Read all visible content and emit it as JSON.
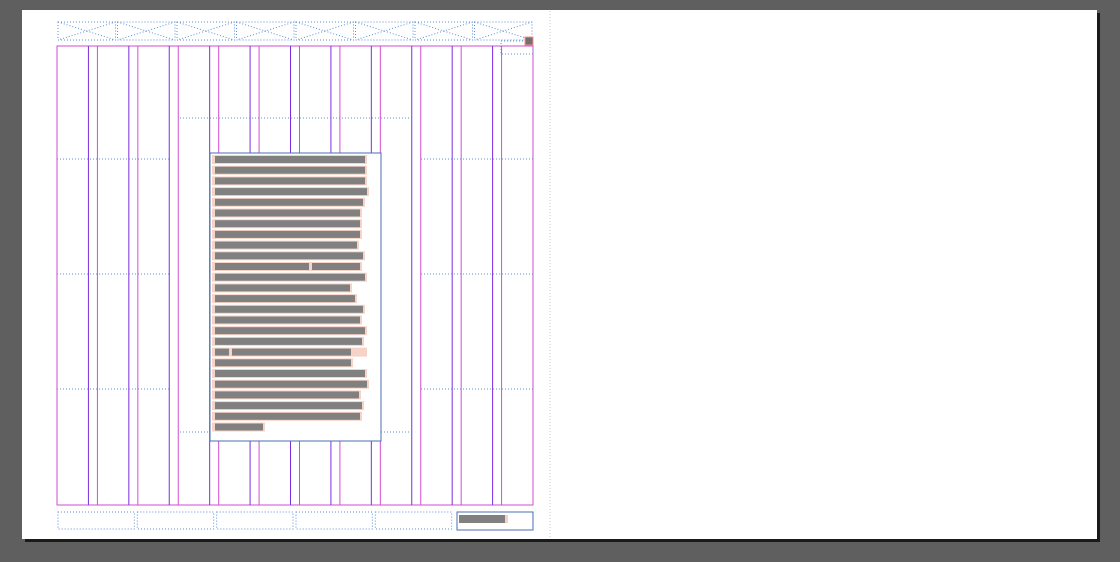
{
  "app": {
    "view": "layout-spread",
    "pages": [
      "left-page",
      "right-page"
    ]
  },
  "colors": {
    "canvas": "#5f5f5f",
    "page": "#ffffff",
    "page_shadow": "#1a1a1a",
    "margin_guide": "#d24ed2",
    "column_guide": "#7b2fe0",
    "baseline_dots": "#5a8fd4",
    "frame_blue": "#4a6fb0",
    "text_highlight": "#f6d3c6",
    "text_greek": "#808080"
  },
  "grid": {
    "columns": 12,
    "header_cells": 8,
    "footer_cells": 6
  },
  "text_frame": {
    "line_count": 26,
    "content": "greeked-text",
    "overset_indicator": "small-square"
  },
  "footer": {
    "page_number": "greeked-text"
  },
  "icons": {
    "placeholder_cell": "x-cross-icon",
    "overset": "overset-marker-icon"
  }
}
